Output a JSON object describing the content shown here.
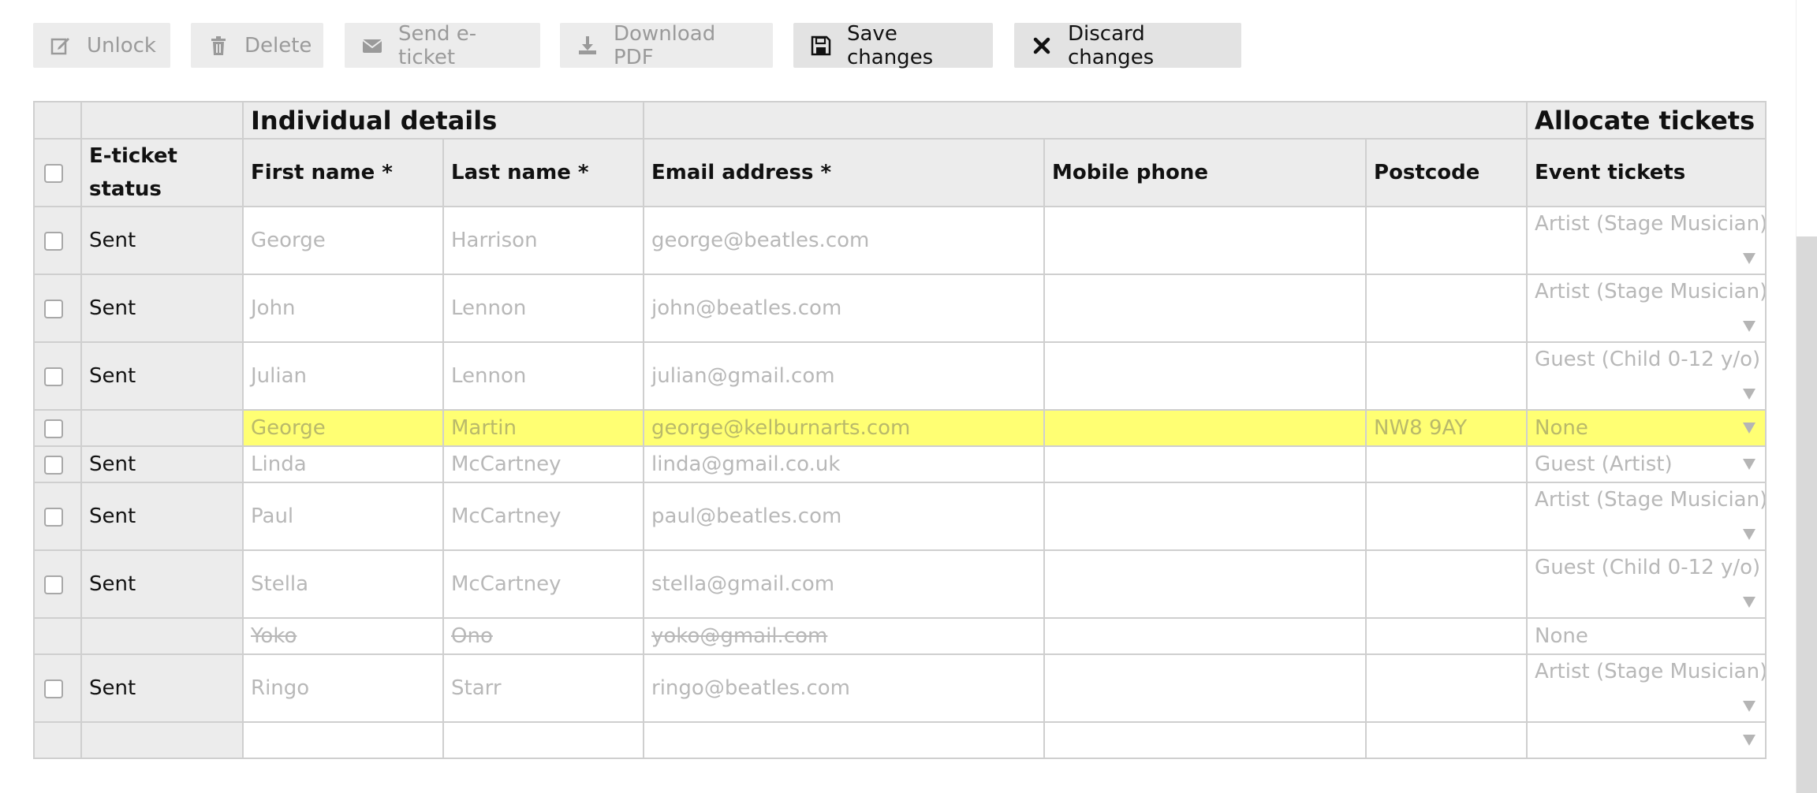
{
  "toolbar": {
    "unlock": "Unlock",
    "delete": "Delete",
    "send": "Send e-ticket",
    "download": "Download PDF",
    "save": "Save changes",
    "discard": "Discard changes"
  },
  "table": {
    "groups": {
      "individual": "Individual details",
      "allocate": "Allocate tickets"
    },
    "headers": {
      "status": "E-ticket status",
      "first": "First name *",
      "last": "Last name *",
      "email": "Email address *",
      "mobile": "Mobile phone",
      "postcode": "Postcode",
      "tickets": "Event tickets"
    },
    "rows": [
      {
        "status": "Sent",
        "first": "George",
        "last": "Harrison",
        "email": "george@beatles.com",
        "mobile": "",
        "postcode": "",
        "ticket": "Artist (Stage Musician)"
      },
      {
        "status": "Sent",
        "first": "John",
        "last": "Lennon",
        "email": "john@beatles.com",
        "mobile": "",
        "postcode": "",
        "ticket": "Artist (Stage Musician)"
      },
      {
        "status": "Sent",
        "first": "Julian",
        "last": "Lennon",
        "email": "julian@gmail.com",
        "mobile": "",
        "postcode": "",
        "ticket": "Guest (Child 0-12 y/o)"
      },
      {
        "status": "",
        "first": "George",
        "last": "Martin",
        "email": "george@kelburnarts.com",
        "mobile": "",
        "postcode": "NW8 9AY",
        "ticket": "None"
      },
      {
        "status": "Sent",
        "first": "Linda",
        "last": "McCartney",
        "email": "linda@gmail.co.uk",
        "mobile": "",
        "postcode": "",
        "ticket": "Guest (Artist)"
      },
      {
        "status": "Sent",
        "first": "Paul",
        "last": "McCartney",
        "email": "paul@beatles.com",
        "mobile": "",
        "postcode": "",
        "ticket": "Artist (Stage Musician)"
      },
      {
        "status": "Sent",
        "first": "Stella",
        "last": "McCartney",
        "email": "stella@gmail.com",
        "mobile": "",
        "postcode": "",
        "ticket": "Guest (Child 0-12 y/o)"
      },
      {
        "status": "",
        "first": "Yoko",
        "last": "Ono",
        "email": "yoko@gmail.com",
        "mobile": "",
        "postcode": "",
        "ticket": "None"
      },
      {
        "status": "Sent",
        "first": "Ringo",
        "last": "Starr",
        "email": "ringo@beatles.com",
        "mobile": "",
        "postcode": "",
        "ticket": "Artist (Stage Musician)"
      },
      {
        "status": "",
        "first": "",
        "last": "",
        "email": "",
        "mobile": "",
        "postcode": "",
        "ticket": ""
      }
    ]
  },
  "icons": {
    "unlock": "edit-icon",
    "delete": "trash-icon",
    "send": "envelope-icon",
    "download": "download-icon",
    "save": "floppy-disk-icon",
    "discard": "close-icon"
  },
  "colors": {
    "highlight": "#ffff73",
    "header_bg": "#ececec"
  }
}
